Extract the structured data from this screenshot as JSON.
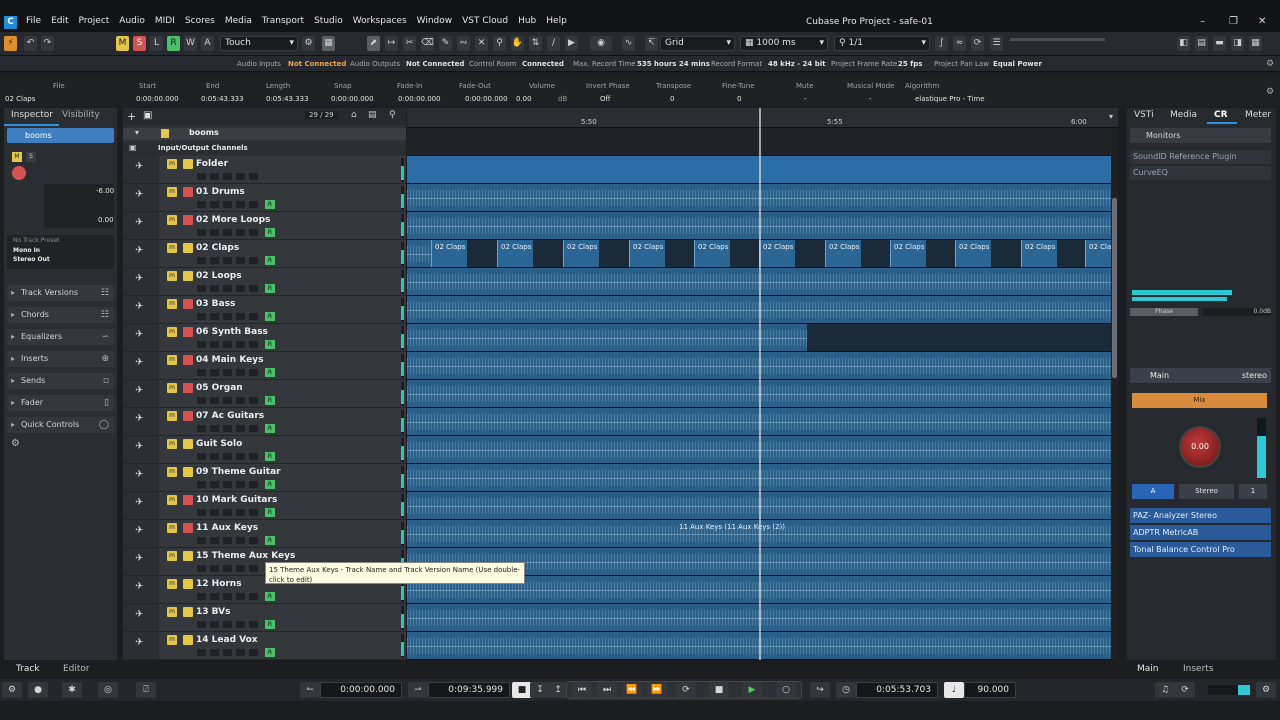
{
  "app": {
    "title": "Cubase Pro Project - safe-01"
  },
  "menu": [
    "File",
    "Edit",
    "Project",
    "Audio",
    "MIDI",
    "Scores",
    "Media",
    "Transport",
    "Studio",
    "Workspaces",
    "Window",
    "VST Cloud",
    "Hub",
    "Help"
  ],
  "toolbar": {
    "mode": "Touch",
    "snap_type": "Grid",
    "grid_value": "1000 ms",
    "quantize": "1/1",
    "m": "M",
    "s": "S",
    "l": "L",
    "r": "R",
    "w": "W",
    "a": "A"
  },
  "status": {
    "audio_inputs_label": "Audio Inputs",
    "audio_inputs_val": "Not Connected",
    "audio_outputs_label": "Audio Outputs",
    "audio_outputs_val": "Not Connected",
    "control_room_label": "Control Room",
    "control_room_val": "Connected",
    "max_record_label": "Max. Record Time",
    "max_record_val": "535 hours 24 mins",
    "record_format_label": "Record Format",
    "record_format_val": "48 kHz - 24 bit",
    "frame_rate_label": "Project Frame Rate",
    "frame_rate_val": "25 fps",
    "pan_law_label": "Project Pan Law",
    "pan_law_val": "Equal Power"
  },
  "infoline": {
    "file_label": "File",
    "file_val": "02 Claps",
    "start_label": "Start",
    "start_val": "0:00:00.000",
    "end_label": "End",
    "end_val": "0:05:43.333",
    "length_label": "Length",
    "length_val": "0:05:43.333",
    "snap_label": "Snap",
    "snap_val": "0:00:00.000",
    "fadein_label": "Fade-In",
    "fadein_val": "0:00:00.000",
    "fadeout_label": "Fade-Out",
    "fadeout_val": "0:00:00.000",
    "volume_label": "Volume",
    "volume_val": "0.00",
    "volume_unit": "dB",
    "invert_label": "Invert Phase",
    "invert_val": "Off",
    "transpose_label": "Transpose",
    "transpose_val": "0",
    "finetune_label": "Fine-Tune",
    "finetune_val": "0",
    "mute_label": "Mute",
    "mute_val": "-",
    "musical_label": "Musical Mode",
    "musical_val": "-",
    "algorithm_label": "Algorithm",
    "algorithm_val": "elastique Pro - Time"
  },
  "inspector": {
    "tab_inspector": "Inspector",
    "tab_visibility": "Visibility",
    "track_name": "booms",
    "volume": "-6.00",
    "pan": "0.00",
    "preset": "No Track Preset",
    "input": "Mono In",
    "output": "Stereo Out",
    "sections": [
      "Track Versions",
      "Chords",
      "Equalizers",
      "Inserts",
      "Sends",
      "Fader",
      "Quick Controls"
    ]
  },
  "tracklist": {
    "counter": "29 / 29",
    "folder_name": "booms",
    "io_label": "Input/Output Channels",
    "tracks": [
      {
        "name": "Folder",
        "color": "#e4c649"
      },
      {
        "name": "01 Drums",
        "color": "#d55252"
      },
      {
        "name": "02 More Loops",
        "color": "#d55252"
      },
      {
        "name": "02 Claps",
        "color": "#e4c649"
      },
      {
        "name": "02 Loops",
        "color": "#e4c649"
      },
      {
        "name": "03 Bass",
        "color": "#d55252"
      },
      {
        "name": "06 Synth Bass",
        "color": "#d55252"
      },
      {
        "name": "04 Main Keys",
        "color": "#d55252"
      },
      {
        "name": "05 Organ",
        "color": "#d55252"
      },
      {
        "name": "07 Ac Guitars",
        "color": "#d55252"
      },
      {
        "name": "Guit Solo",
        "color": "#e4c649"
      },
      {
        "name": "09 Theme Guitar",
        "color": "#e4c649"
      },
      {
        "name": "10 Mark Guitars",
        "color": "#d55252"
      },
      {
        "name": "11 Aux Keys",
        "color": "#d55252"
      },
      {
        "name": "15 Theme Aux Keys",
        "color": "#e4c649"
      },
      {
        "name": "12 Horns",
        "color": "#e4c649"
      },
      {
        "name": "13 BVs",
        "color": "#e4c649"
      },
      {
        "name": "14 Lead Vox",
        "color": "#e4c649"
      }
    ]
  },
  "ruler": {
    "ticks": [
      "5:50",
      "5:55",
      "6:00"
    ]
  },
  "arrange": {
    "clap_clip": "02 Claps",
    "aux_clip": "11 Aux Keys (11 Aux Keys (2))"
  },
  "tooltip": "15 Theme Aux Keys - Track Name and Track Version Name (Use double-click to edit)",
  "rightzone": {
    "tabs": [
      "VSTi",
      "Media",
      "CR",
      "Meter"
    ],
    "monitors": "Monitors",
    "plugins_top": [
      "SoundID Reference Plugin",
      "CurveEQ"
    ],
    "phase": "Phase",
    "phase_val": "0.0dB",
    "main": "Main",
    "stereo": "stereo",
    "mix": "Mix",
    "knob": "0.00",
    "a_btn": "A",
    "stereo_btn": "Stereo",
    "one_btn": "1",
    "inserts": [
      "PAZ- Analyzer Stereo",
      "ADPTR MetricAB",
      "Tonal Balance Control Pro"
    ]
  },
  "bottomtabs": {
    "track": "Track",
    "editor": "Editor",
    "main": "Main",
    "inserts": "Inserts"
  },
  "transport": {
    "left_locator": "0:00:00.000",
    "right_locator": "0:09:35.999",
    "position": "0:05:53.703",
    "tempo": "90.000"
  }
}
